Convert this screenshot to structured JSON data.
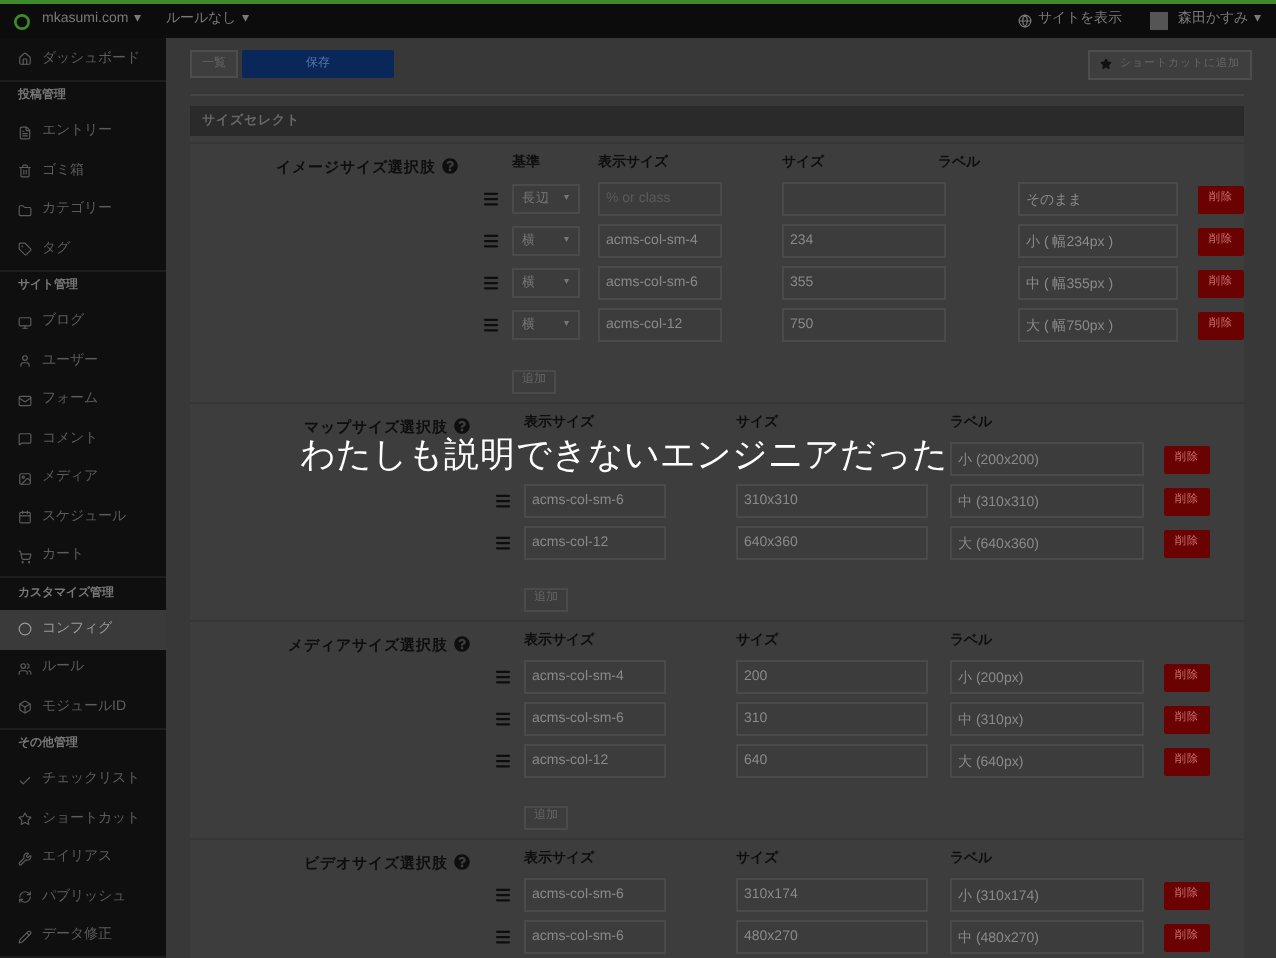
{
  "topbar": {
    "site": "mkasumi.com",
    "site_caret": "▾",
    "rule": "ルールなし",
    "rule_caret": "▾",
    "view_site": "サイトを表示",
    "user": "森田かすみ",
    "user_caret": "▾"
  },
  "sidebar": {
    "sections": [
      {
        "items": [
          {
            "label": "ダッシュボード",
            "selected": false
          }
        ]
      },
      {
        "heading": "投稿管理",
        "items": [
          {
            "label": "エントリー",
            "selected": false
          },
          {
            "label": "ゴミ箱",
            "selected": false
          },
          {
            "label": "カテゴリー",
            "selected": false
          },
          {
            "label": "タグ",
            "selected": false
          }
        ]
      },
      {
        "heading": "サイト管理",
        "items": [
          {
            "label": "ブログ",
            "selected": false
          },
          {
            "label": "ユーザー",
            "selected": false
          },
          {
            "label": "フォーム",
            "selected": false
          },
          {
            "label": "コメント",
            "selected": false
          },
          {
            "label": "メディア",
            "selected": false
          },
          {
            "label": "スケジュール",
            "selected": false
          },
          {
            "label": "カート",
            "selected": false
          }
        ]
      },
      {
        "heading": "カスタマイズ管理",
        "items": [
          {
            "label": "コンフィグ",
            "selected": true
          },
          {
            "label": "ルール",
            "selected": false
          },
          {
            "label": "モジュールID",
            "selected": false
          }
        ]
      },
      {
        "heading": "その他管理",
        "items": [
          {
            "label": "チェックリスト",
            "selected": false
          },
          {
            "label": "ショートカット",
            "selected": false
          },
          {
            "label": "エイリアス",
            "selected": false
          },
          {
            "label": "パブリッシュ",
            "selected": false
          },
          {
            "label": "データ修正",
            "selected": false
          }
        ]
      }
    ]
  },
  "toolbar": {
    "list_button": "一覧",
    "save_button": "保存",
    "shortcut_button": "ショートカットに追加"
  },
  "panel": {
    "title": "サイズセレクト",
    "groups": [
      {
        "kind": "with_basis",
        "label": "イメージサイズ選択肢",
        "columns": [
          "基準",
          "表示サイズ",
          "サイズ",
          "ラベル"
        ],
        "add_button": "追加",
        "rows": [
          {
            "basis": "長辺",
            "caret": "▾",
            "display_placeholder": "% or class",
            "label": "そのまま",
            "delete": "削除"
          },
          {
            "basis": "横",
            "caret": "▾",
            "display": "acms-col-sm-4",
            "size": "234",
            "label": "小 ( 幅234px )",
            "delete": "削除"
          },
          {
            "basis": "横",
            "caret": "▾",
            "display": "acms-col-sm-6",
            "size": "355",
            "label": "中 ( 幅355px )",
            "delete": "削除"
          },
          {
            "basis": "横",
            "caret": "▾",
            "display": "acms-col-12",
            "size": "750",
            "label": "大 ( 幅750px )",
            "delete": "削除"
          }
        ]
      },
      {
        "kind": "plain",
        "label": "マップサイズ選択肢",
        "columns": [
          "表示サイズ",
          "サイズ",
          "ラベル"
        ],
        "add_button": "追加",
        "rows": [
          {
            "label": "小 (200x200)",
            "delete": "削除"
          },
          {
            "display": "acms-col-sm-6",
            "size": "310x310",
            "label": "中 (310x310)",
            "delete": "削除"
          },
          {
            "display": "acms-col-12",
            "size": "640x360",
            "label": "大 (640x360)",
            "delete": "削除"
          }
        ]
      },
      {
        "kind": "plain",
        "label": "メディアサイズ選択肢",
        "columns": [
          "表示サイズ",
          "サイズ",
          "ラベル"
        ],
        "add_button": "追加",
        "rows": [
          {
            "display": "acms-col-sm-4",
            "size": "200",
            "label": "小 (200px)",
            "delete": "削除"
          },
          {
            "display": "acms-col-sm-6",
            "size": "310",
            "label": "中 (310px)",
            "delete": "削除"
          },
          {
            "display": "acms-col-12",
            "size": "640",
            "label": "大 (640px)",
            "delete": "削除"
          }
        ]
      },
      {
        "kind": "plain",
        "label": "ビデオサイズ選択肢",
        "columns": [
          "表示サイズ",
          "サイズ",
          "ラベル"
        ],
        "rows": [
          {
            "display": "acms-col-sm-6",
            "size": "310x174",
            "label": "小 (310x174)",
            "delete": "削除"
          },
          {
            "display": "acms-col-sm-6",
            "size": "480x270",
            "label": "中 (480x270)",
            "delete": "削除"
          }
        ]
      }
    ]
  },
  "caption": "わたしも説明できないエンジニアだった"
}
